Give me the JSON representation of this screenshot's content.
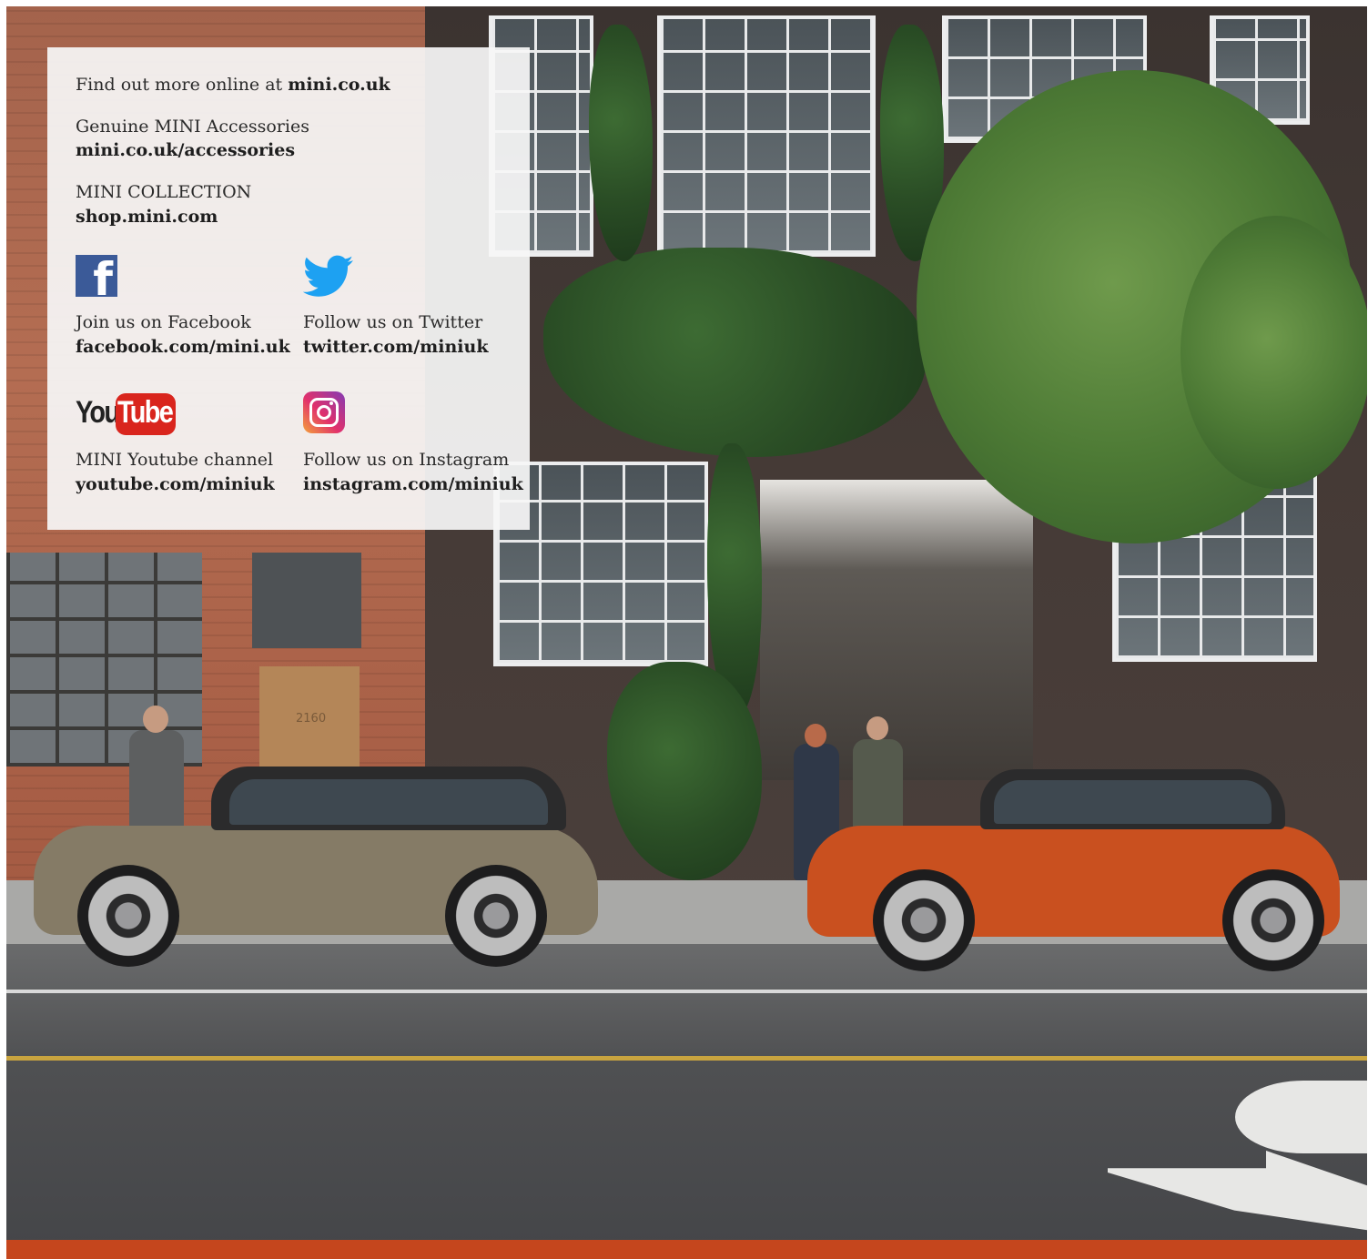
{
  "panel": {
    "intro": {
      "text": "Find out more online at ",
      "link": "mini.co.uk"
    },
    "accessories": {
      "label": "Genuine MINI Accessories",
      "link": "mini.co.uk/accessories"
    },
    "collection": {
      "label": "MINI COLLECTION",
      "link": "shop.mini.com"
    },
    "facebook": {
      "icon": "facebook-icon",
      "label": "Join us on Facebook",
      "link": "facebook.com/mini.uk",
      "glyph": "f"
    },
    "twitter": {
      "icon": "twitter-bird-icon",
      "label": "Follow us on Twitter",
      "link": "twitter.com/miniuk"
    },
    "youtube": {
      "icon": "youtube-logo",
      "label": "MINI Youtube channel",
      "link": "youtube.com/miniuk",
      "logo_you": "You",
      "logo_tube": "Tube"
    },
    "instagram": {
      "icon": "instagram-icon",
      "label": "Follow us on Instagram",
      "link": "instagram.com/miniuk"
    }
  },
  "scene": {
    "door_number": "2160"
  },
  "colors": {
    "facebook_blue": "#3b5a98",
    "twitter_blue": "#1da1f2",
    "youtube_red": "#d9251d",
    "footer_bar": "#c5461d",
    "car_left": "#857b66",
    "car_right": "#c9501f"
  }
}
